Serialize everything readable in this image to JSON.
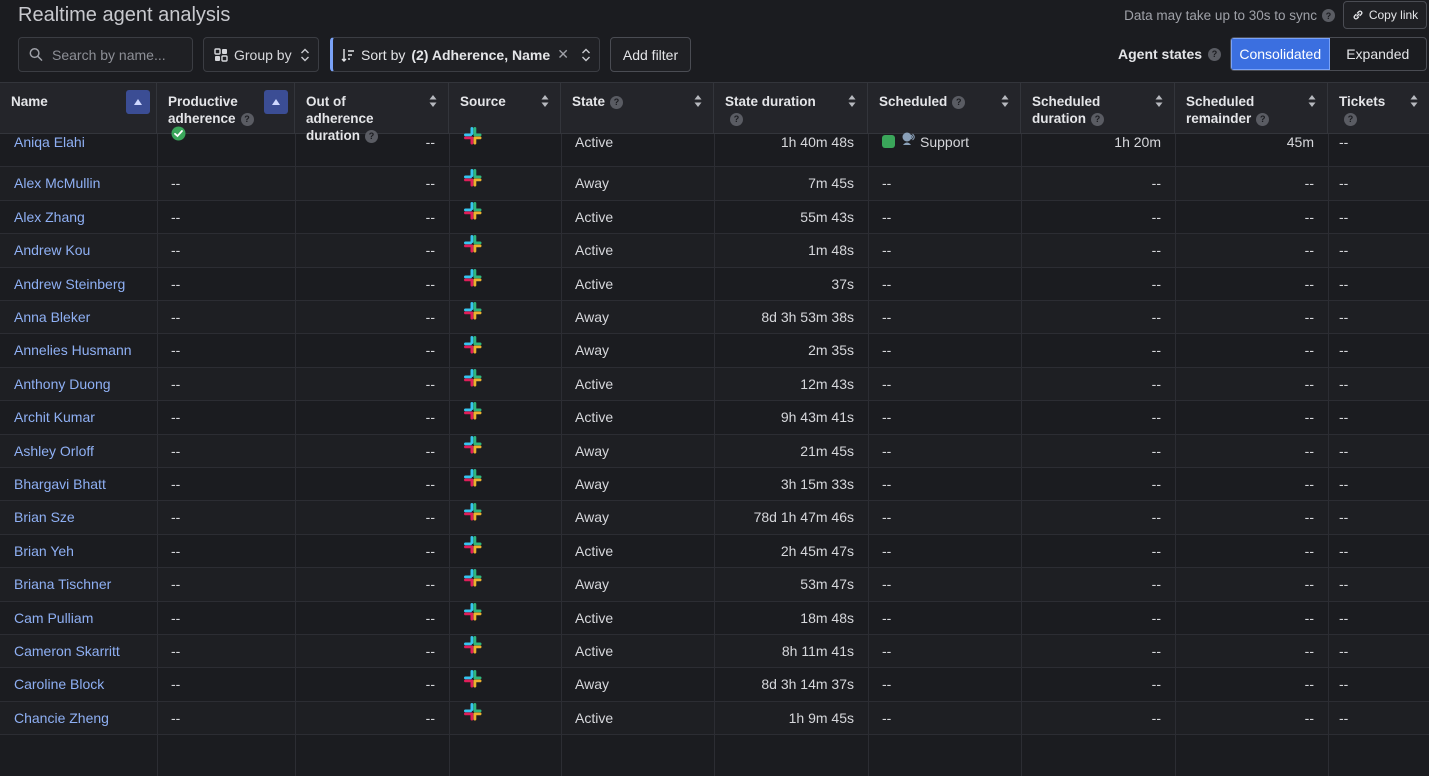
{
  "header": {
    "title": "Realtime agent analysis",
    "sync_note": "Data may take up to 30s to sync",
    "copy_link": "Copy link"
  },
  "toolbar": {
    "search_placeholder": "Search by name...",
    "group_by": "Group by",
    "sort_prefix": "Sort by",
    "sort_value": "(2) Adherence, Name",
    "add_filter": "Add filter",
    "agent_states_label": "Agent states",
    "view_options": [
      "Consolidated",
      "Expanded"
    ],
    "active_view": "Consolidated"
  },
  "columns": [
    {
      "label": "Name",
      "help": false
    },
    {
      "label": "Productive adherence",
      "help": true
    },
    {
      "label": "Out of adherence duration",
      "help": true
    },
    {
      "label": "Source",
      "help": false
    },
    {
      "label": "State",
      "help": true
    },
    {
      "label": "State duration",
      "help": true
    },
    {
      "label": "Scheduled",
      "help": true
    },
    {
      "label": "Scheduled duration",
      "help": true
    },
    {
      "label": "Scheduled remainder",
      "help": true
    },
    {
      "label": "Tickets",
      "help": true
    }
  ],
  "rows": [
    {
      "name": "Aniqa Elahi",
      "adherence": "check",
      "ooa": "--",
      "state": "Active",
      "state_duration": "1h 40m 48s",
      "scheduled": "Support",
      "scheduled_duration": "1h 20m",
      "scheduled_remainder": "45m",
      "tickets": "--"
    },
    {
      "name": "Alex McMullin",
      "adherence": "--",
      "ooa": "--",
      "state": "Away",
      "state_duration": "7m 45s",
      "scheduled": "--",
      "scheduled_duration": "--",
      "scheduled_remainder": "--",
      "tickets": "--"
    },
    {
      "name": "Alex Zhang",
      "adherence": "--",
      "ooa": "--",
      "state": "Active",
      "state_duration": "55m 43s",
      "scheduled": "--",
      "scheduled_duration": "--",
      "scheduled_remainder": "--",
      "tickets": "--"
    },
    {
      "name": "Andrew Kou",
      "adherence": "--",
      "ooa": "--",
      "state": "Active",
      "state_duration": "1m 48s",
      "scheduled": "--",
      "scheduled_duration": "--",
      "scheduled_remainder": "--",
      "tickets": "--"
    },
    {
      "name": "Andrew Steinberg",
      "adherence": "--",
      "ooa": "--",
      "state": "Active",
      "state_duration": "37s",
      "scheduled": "--",
      "scheduled_duration": "--",
      "scheduled_remainder": "--",
      "tickets": "--"
    },
    {
      "name": "Anna Bleker",
      "adherence": "--",
      "ooa": "--",
      "state": "Away",
      "state_duration": "8d 3h 53m 38s",
      "scheduled": "--",
      "scheduled_duration": "--",
      "scheduled_remainder": "--",
      "tickets": "--"
    },
    {
      "name": "Annelies Husmann",
      "adherence": "--",
      "ooa": "--",
      "state": "Away",
      "state_duration": "2m 35s",
      "scheduled": "--",
      "scheduled_duration": "--",
      "scheduled_remainder": "--",
      "tickets": "--"
    },
    {
      "name": "Anthony Duong",
      "adherence": "--",
      "ooa": "--",
      "state": "Active",
      "state_duration": "12m 43s",
      "scheduled": "--",
      "scheduled_duration": "--",
      "scheduled_remainder": "--",
      "tickets": "--"
    },
    {
      "name": "Archit Kumar",
      "adherence": "--",
      "ooa": "--",
      "state": "Active",
      "state_duration": "9h 43m 41s",
      "scheduled": "--",
      "scheduled_duration": "--",
      "scheduled_remainder": "--",
      "tickets": "--"
    },
    {
      "name": "Ashley Orloff",
      "adherence": "--",
      "ooa": "--",
      "state": "Away",
      "state_duration": "21m 45s",
      "scheduled": "--",
      "scheduled_duration": "--",
      "scheduled_remainder": "--",
      "tickets": "--"
    },
    {
      "name": "Bhargavi Bhatt",
      "adherence": "--",
      "ooa": "--",
      "state": "Away",
      "state_duration": "3h 15m 33s",
      "scheduled": "--",
      "scheduled_duration": "--",
      "scheduled_remainder": "--",
      "tickets": "--"
    },
    {
      "name": "Brian Sze",
      "adherence": "--",
      "ooa": "--",
      "state": "Away",
      "state_duration": "78d 1h 47m 46s",
      "scheduled": "--",
      "scheduled_duration": "--",
      "scheduled_remainder": "--",
      "tickets": "--"
    },
    {
      "name": "Brian Yeh",
      "adherence": "--",
      "ooa": "--",
      "state": "Active",
      "state_duration": "2h 45m 47s",
      "scheduled": "--",
      "scheduled_duration": "--",
      "scheduled_remainder": "--",
      "tickets": "--"
    },
    {
      "name": "Briana Tischner",
      "adherence": "--",
      "ooa": "--",
      "state": "Away",
      "state_duration": "53m 47s",
      "scheduled": "--",
      "scheduled_duration": "--",
      "scheduled_remainder": "--",
      "tickets": "--"
    },
    {
      "name": "Cam Pulliam",
      "adherence": "--",
      "ooa": "--",
      "state": "Active",
      "state_duration": "18m 48s",
      "scheduled": "--",
      "scheduled_duration": "--",
      "scheduled_remainder": "--",
      "tickets": "--"
    },
    {
      "name": "Cameron Skarritt",
      "adherence": "--",
      "ooa": "--",
      "state": "Active",
      "state_duration": "8h 11m 41s",
      "scheduled": "--",
      "scheduled_duration": "--",
      "scheduled_remainder": "--",
      "tickets": "--"
    },
    {
      "name": "Caroline Block",
      "adherence": "--",
      "ooa": "--",
      "state": "Away",
      "state_duration": "8d 3h 14m 37s",
      "scheduled": "--",
      "scheduled_duration": "--",
      "scheduled_remainder": "--",
      "tickets": "--"
    },
    {
      "name": "Chancie Zheng",
      "adherence": "--",
      "ooa": "--",
      "state": "Active",
      "state_duration": "1h 9m 45s",
      "scheduled": "--",
      "scheduled_duration": "--",
      "scheduled_remainder": "--",
      "tickets": "--"
    }
  ],
  "source_icon": "slack-icon",
  "colors": {
    "accent": "#3b6fe0",
    "link": "#8fb0f4",
    "background": "#1b1c20",
    "check": "#3aa65a",
    "scheduled_swatch": "#3aa65a"
  }
}
